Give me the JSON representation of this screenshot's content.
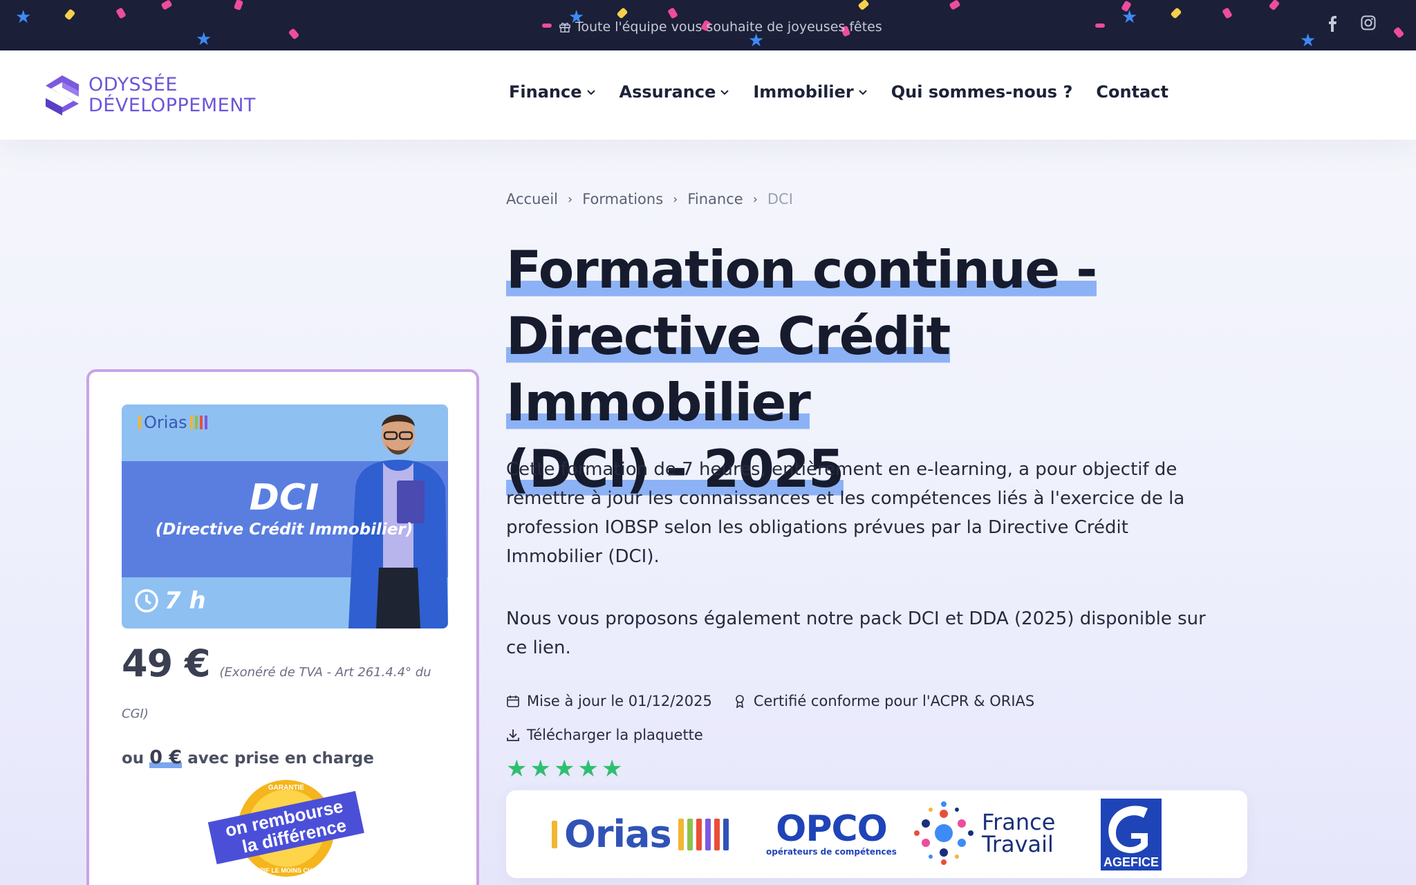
{
  "topbar": {
    "message": "Toute l'équipe vous souhaite de joyeuses fêtes",
    "social": [
      {
        "icon": "facebook-icon"
      },
      {
        "icon": "instagram-icon"
      }
    ]
  },
  "header": {
    "logo_line1": "ODYSSÉE",
    "logo_line2": "DÉVELOPPEMENT",
    "nav": [
      {
        "label": "Finance",
        "dropdown": true
      },
      {
        "label": "Assurance",
        "dropdown": true
      },
      {
        "label": "Immobilier",
        "dropdown": true
      },
      {
        "label": "Qui sommes-nous ?",
        "dropdown": false
      },
      {
        "label": "Contact",
        "dropdown": false
      }
    ]
  },
  "breadcrumb": [
    "Accueil",
    "Formations",
    "Finance",
    "DCI"
  ],
  "title": {
    "line1": "Formation continue -",
    "line2": "Directive Crédit Immobilier",
    "line3": "(DCI) - 2025"
  },
  "description": {
    "p1": "Cette formation de 7 heures, entièrement en e-learning, a pour objectif de remettre à jour les connaissances et les compétences liés à l'exercice de la profession IOBSP selon les obligations prévues par la Directive Crédit Immobilier (DCI).",
    "p2": "Nous vous proposons également notre pack DCI et DDA (2025) disponible sur ce lien."
  },
  "meta": {
    "updated": "Mise à jour le 01/12/2025",
    "certified": "Certifié conforme pour l'ACPR & ORIAS",
    "download": "Télécharger la plaquette"
  },
  "rating": 5,
  "partners": {
    "orias": "Orias",
    "opco": "OPCO",
    "opco_sub": "opérateurs de compétences",
    "francetravail_1": "France",
    "francetravail_2": "Travail",
    "agefice": "AGEFICE"
  },
  "card": {
    "promo_brand": "Orias",
    "promo_title": "DCI",
    "promo_subtitle": "(Directive Crédit Immobilier)",
    "promo_duration": "7 h",
    "price": "49 €",
    "price_note": "(Exonéré de TVA - Art 261.4.4° du",
    "price_note_cont": "CGI)",
    "alt_prefix": "ou",
    "alt_price": "0 €",
    "alt_suffix": "avec prise en charge",
    "badge_top": "GARANTIE",
    "badge_line1": "on rembourse",
    "badge_line2": "la différence",
    "badge_bottom": "TARIF LE MOINS CHER"
  },
  "colors": {
    "topbar": "#1b1f38",
    "brand": "#6d55d8",
    "highlight": "#8cb2f5",
    "card_border": "#c9a3e6",
    "star": "#2fbf71"
  }
}
